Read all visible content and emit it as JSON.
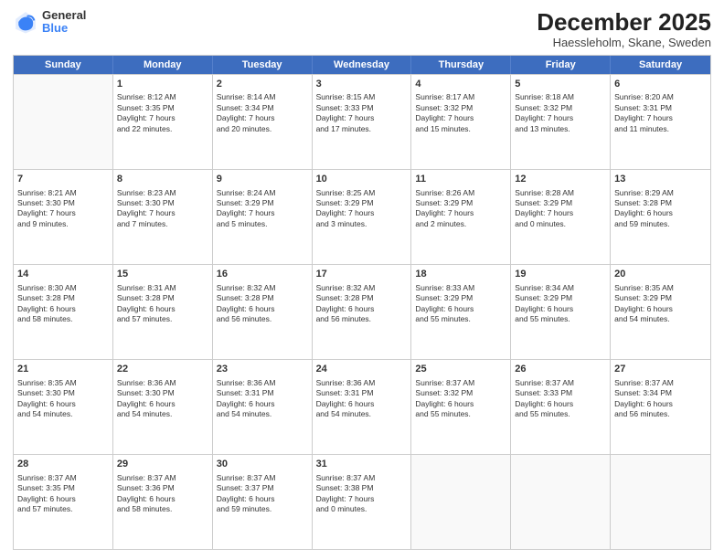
{
  "header": {
    "logo_general": "General",
    "logo_blue": "Blue",
    "month_title": "December 2025",
    "location": "Haessleholm, Skane, Sweden"
  },
  "days_of_week": [
    "Sunday",
    "Monday",
    "Tuesday",
    "Wednesday",
    "Thursday",
    "Friday",
    "Saturday"
  ],
  "weeks": [
    [
      {
        "day": "",
        "sunrise": "",
        "sunset": "",
        "daylight": "",
        "empty": true
      },
      {
        "day": "1",
        "sunrise": "Sunrise: 8:12 AM",
        "sunset": "Sunset: 3:35 PM",
        "daylight": "Daylight: 7 hours",
        "daylight2": "and 22 minutes."
      },
      {
        "day": "2",
        "sunrise": "Sunrise: 8:14 AM",
        "sunset": "Sunset: 3:34 PM",
        "daylight": "Daylight: 7 hours",
        "daylight2": "and 20 minutes."
      },
      {
        "day": "3",
        "sunrise": "Sunrise: 8:15 AM",
        "sunset": "Sunset: 3:33 PM",
        "daylight": "Daylight: 7 hours",
        "daylight2": "and 17 minutes."
      },
      {
        "day": "4",
        "sunrise": "Sunrise: 8:17 AM",
        "sunset": "Sunset: 3:32 PM",
        "daylight": "Daylight: 7 hours",
        "daylight2": "and 15 minutes."
      },
      {
        "day": "5",
        "sunrise": "Sunrise: 8:18 AM",
        "sunset": "Sunset: 3:32 PM",
        "daylight": "Daylight: 7 hours",
        "daylight2": "and 13 minutes."
      },
      {
        "day": "6",
        "sunrise": "Sunrise: 8:20 AM",
        "sunset": "Sunset: 3:31 PM",
        "daylight": "Daylight: 7 hours",
        "daylight2": "and 11 minutes."
      }
    ],
    [
      {
        "day": "7",
        "sunrise": "Sunrise: 8:21 AM",
        "sunset": "Sunset: 3:30 PM",
        "daylight": "Daylight: 7 hours",
        "daylight2": "and 9 minutes."
      },
      {
        "day": "8",
        "sunrise": "Sunrise: 8:23 AM",
        "sunset": "Sunset: 3:30 PM",
        "daylight": "Daylight: 7 hours",
        "daylight2": "and 7 minutes."
      },
      {
        "day": "9",
        "sunrise": "Sunrise: 8:24 AM",
        "sunset": "Sunset: 3:29 PM",
        "daylight": "Daylight: 7 hours",
        "daylight2": "and 5 minutes."
      },
      {
        "day": "10",
        "sunrise": "Sunrise: 8:25 AM",
        "sunset": "Sunset: 3:29 PM",
        "daylight": "Daylight: 7 hours",
        "daylight2": "and 3 minutes."
      },
      {
        "day": "11",
        "sunrise": "Sunrise: 8:26 AM",
        "sunset": "Sunset: 3:29 PM",
        "daylight": "Daylight: 7 hours",
        "daylight2": "and 2 minutes."
      },
      {
        "day": "12",
        "sunrise": "Sunrise: 8:28 AM",
        "sunset": "Sunset: 3:29 PM",
        "daylight": "Daylight: 7 hours",
        "daylight2": "and 0 minutes."
      },
      {
        "day": "13",
        "sunrise": "Sunrise: 8:29 AM",
        "sunset": "Sunset: 3:28 PM",
        "daylight": "Daylight: 6 hours",
        "daylight2": "and 59 minutes."
      }
    ],
    [
      {
        "day": "14",
        "sunrise": "Sunrise: 8:30 AM",
        "sunset": "Sunset: 3:28 PM",
        "daylight": "Daylight: 6 hours",
        "daylight2": "and 58 minutes."
      },
      {
        "day": "15",
        "sunrise": "Sunrise: 8:31 AM",
        "sunset": "Sunset: 3:28 PM",
        "daylight": "Daylight: 6 hours",
        "daylight2": "and 57 minutes."
      },
      {
        "day": "16",
        "sunrise": "Sunrise: 8:32 AM",
        "sunset": "Sunset: 3:28 PM",
        "daylight": "Daylight: 6 hours",
        "daylight2": "and 56 minutes."
      },
      {
        "day": "17",
        "sunrise": "Sunrise: 8:32 AM",
        "sunset": "Sunset: 3:28 PM",
        "daylight": "Daylight: 6 hours",
        "daylight2": "and 56 minutes."
      },
      {
        "day": "18",
        "sunrise": "Sunrise: 8:33 AM",
        "sunset": "Sunset: 3:29 PM",
        "daylight": "Daylight: 6 hours",
        "daylight2": "and 55 minutes."
      },
      {
        "day": "19",
        "sunrise": "Sunrise: 8:34 AM",
        "sunset": "Sunset: 3:29 PM",
        "daylight": "Daylight: 6 hours",
        "daylight2": "and 55 minutes."
      },
      {
        "day": "20",
        "sunrise": "Sunrise: 8:35 AM",
        "sunset": "Sunset: 3:29 PM",
        "daylight": "Daylight: 6 hours",
        "daylight2": "and 54 minutes."
      }
    ],
    [
      {
        "day": "21",
        "sunrise": "Sunrise: 8:35 AM",
        "sunset": "Sunset: 3:30 PM",
        "daylight": "Daylight: 6 hours",
        "daylight2": "and 54 minutes."
      },
      {
        "day": "22",
        "sunrise": "Sunrise: 8:36 AM",
        "sunset": "Sunset: 3:30 PM",
        "daylight": "Daylight: 6 hours",
        "daylight2": "and 54 minutes."
      },
      {
        "day": "23",
        "sunrise": "Sunrise: 8:36 AM",
        "sunset": "Sunset: 3:31 PM",
        "daylight": "Daylight: 6 hours",
        "daylight2": "and 54 minutes."
      },
      {
        "day": "24",
        "sunrise": "Sunrise: 8:36 AM",
        "sunset": "Sunset: 3:31 PM",
        "daylight": "Daylight: 6 hours",
        "daylight2": "and 54 minutes."
      },
      {
        "day": "25",
        "sunrise": "Sunrise: 8:37 AM",
        "sunset": "Sunset: 3:32 PM",
        "daylight": "Daylight: 6 hours",
        "daylight2": "and 55 minutes."
      },
      {
        "day": "26",
        "sunrise": "Sunrise: 8:37 AM",
        "sunset": "Sunset: 3:33 PM",
        "daylight": "Daylight: 6 hours",
        "daylight2": "and 55 minutes."
      },
      {
        "day": "27",
        "sunrise": "Sunrise: 8:37 AM",
        "sunset": "Sunset: 3:34 PM",
        "daylight": "Daylight: 6 hours",
        "daylight2": "and 56 minutes."
      }
    ],
    [
      {
        "day": "28",
        "sunrise": "Sunrise: 8:37 AM",
        "sunset": "Sunset: 3:35 PM",
        "daylight": "Daylight: 6 hours",
        "daylight2": "and 57 minutes."
      },
      {
        "day": "29",
        "sunrise": "Sunrise: 8:37 AM",
        "sunset": "Sunset: 3:36 PM",
        "daylight": "Daylight: 6 hours",
        "daylight2": "and 58 minutes."
      },
      {
        "day": "30",
        "sunrise": "Sunrise: 8:37 AM",
        "sunset": "Sunset: 3:37 PM",
        "daylight": "Daylight: 6 hours",
        "daylight2": "and 59 minutes."
      },
      {
        "day": "31",
        "sunrise": "Sunrise: 8:37 AM",
        "sunset": "Sunset: 3:38 PM",
        "daylight": "Daylight: 7 hours",
        "daylight2": "and 0 minutes."
      },
      {
        "day": "",
        "sunrise": "",
        "sunset": "",
        "daylight": "",
        "daylight2": "",
        "empty": true
      },
      {
        "day": "",
        "sunrise": "",
        "sunset": "",
        "daylight": "",
        "daylight2": "",
        "empty": true
      },
      {
        "day": "",
        "sunrise": "",
        "sunset": "",
        "daylight": "",
        "daylight2": "",
        "empty": true
      }
    ]
  ]
}
